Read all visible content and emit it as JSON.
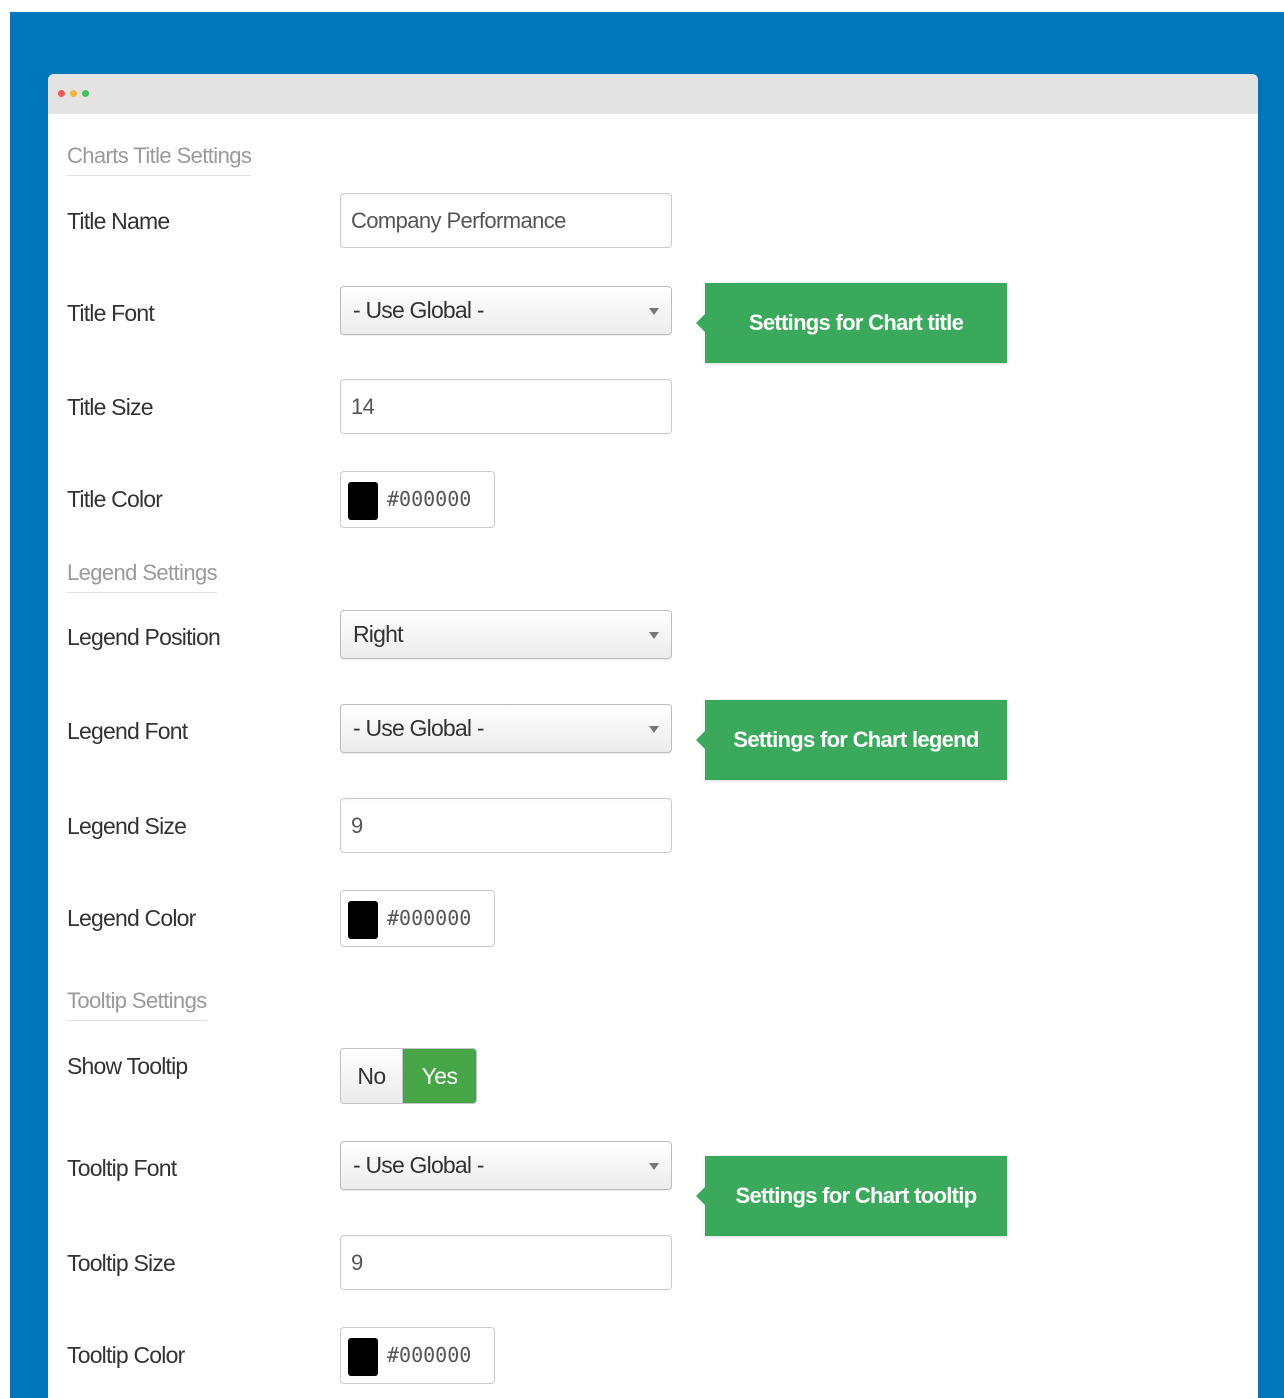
{
  "window": {
    "controls": [
      "red-dot",
      "yellow-dot",
      "green-dot"
    ]
  },
  "sections": {
    "title": {
      "heading": "Charts Title Settings",
      "name_label": "Title Name",
      "name_value": "Company Performance",
      "font_label": "Title Font",
      "font_value": "- Use Global -",
      "size_label": "Title Size",
      "size_value": "14",
      "color_label": "Title Color",
      "color_value": "#000000",
      "callout": "Settings for Chart title"
    },
    "legend": {
      "heading": "Legend Settings",
      "position_label": "Legend Position",
      "position_value": "Right",
      "font_label": "Legend Font",
      "font_value": "- Use Global -",
      "size_label": "Legend Size",
      "size_value": "9",
      "color_label": "Legend Color",
      "color_value": "#000000",
      "callout": "Settings for Chart legend"
    },
    "tooltip": {
      "heading": "Tooltip Settings",
      "show_label": "Show Tooltip",
      "show_no": "No",
      "show_yes": "Yes",
      "show_selected": "Yes",
      "font_label": "Tooltip Font",
      "font_value": "- Use Global -",
      "size_label": "Tooltip Size",
      "size_value": "9",
      "color_label": "Tooltip Color",
      "color_value": "#000000",
      "callout": "Settings for Chart tooltip"
    }
  },
  "colors": {
    "backdrop": "#0077bb",
    "callout": "#3aa95b",
    "toggle_active": "#46a546",
    "swatch": "#000000"
  }
}
